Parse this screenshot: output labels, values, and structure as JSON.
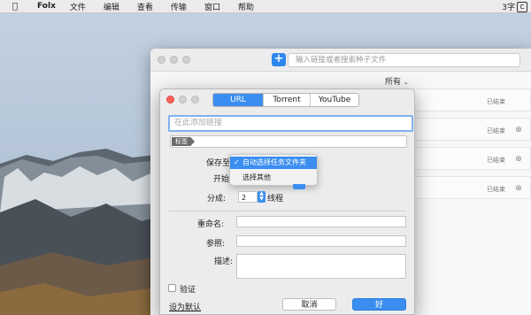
{
  "menubar": {
    "app_name": "Folx",
    "items": [
      "文件",
      "编辑",
      "查看",
      "传输",
      "窗口",
      "帮助"
    ],
    "status_text": "3字",
    "ime_icon": "C"
  },
  "main_window": {
    "search_placeholder": "输入链接或者搜索种子文件",
    "filter_label": "所有",
    "rows": [
      {
        "status": "已结束"
      },
      {
        "status": "已结束"
      },
      {
        "status": "已结束"
      },
      {
        "status": "已结束"
      }
    ]
  },
  "dialog": {
    "tabs": [
      "URL",
      "Torrent",
      "YouTube"
    ],
    "url_placeholder": "在此添加链接",
    "tag_label": "标签",
    "save_to_label": "保存至",
    "start_label": "开始",
    "dropdown": {
      "selected": "自动选择任务文件夹",
      "other": "选择其他"
    },
    "split_label": "分成:",
    "split_value": "2",
    "threads_label": "线程",
    "rename_label": "重命名:",
    "reference_label": "参照:",
    "description_label": "描述:",
    "auth_label": "验证",
    "set_default_label": "设为默认",
    "cancel_label": "取消",
    "ok_label": "好"
  },
  "colors": {
    "accent": "#3b8ef0",
    "close": "#fc5f57"
  }
}
